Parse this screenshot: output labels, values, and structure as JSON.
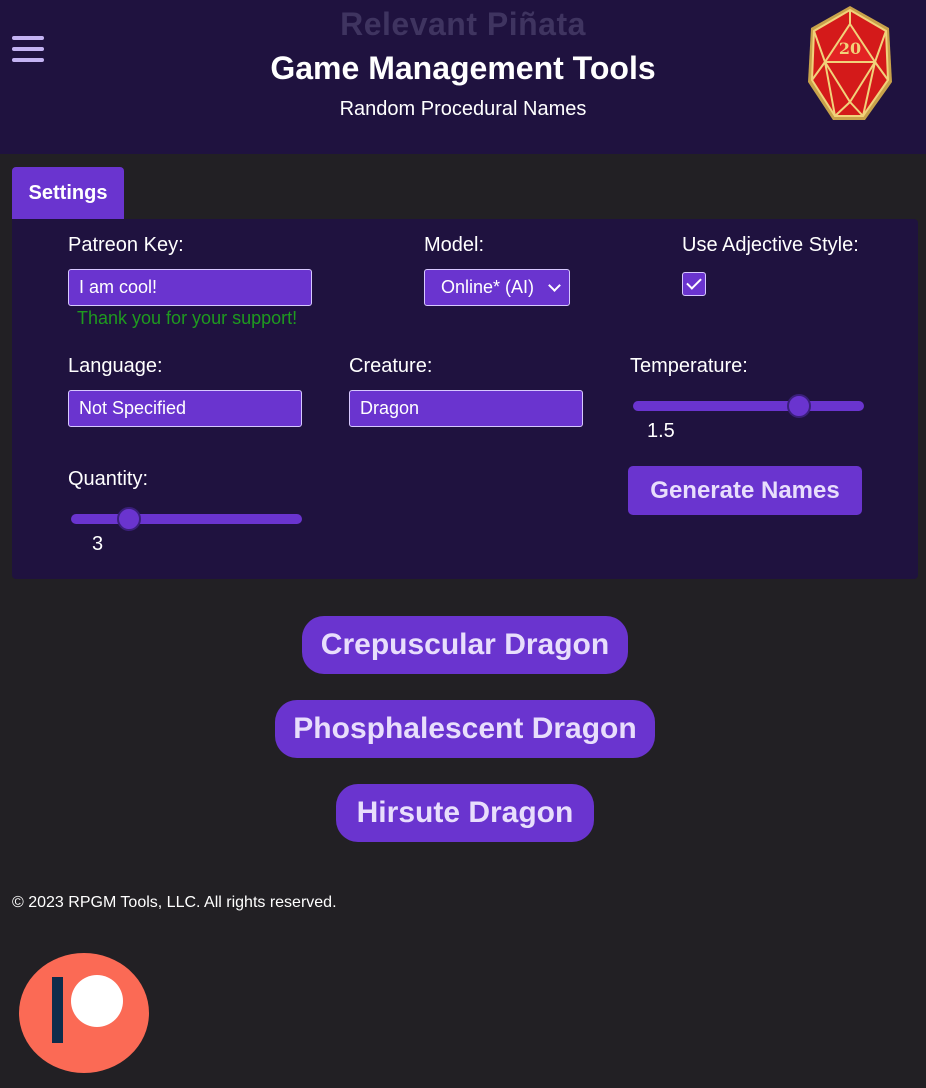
{
  "header": {
    "brand": "Relevant Piñata",
    "title": "Game Management Tools",
    "subtitle": "Random Procedural Names",
    "d20_number": "20"
  },
  "settings": {
    "tab_label": "Settings",
    "patreon_label": "Patreon Key:",
    "patreon_value": "I am cool!",
    "support_message": "Thank you for your support!",
    "model_label": "Model:",
    "model_value": "Online* (AI)",
    "adjective_label": "Use Adjective Style:",
    "adjective_checked": true,
    "language_label": "Language:",
    "language_value": "Not Specified",
    "creature_label": "Creature:",
    "creature_value": "Dragon",
    "temperature_label": "Temperature:",
    "temperature_value": "1.5",
    "temperature_fraction": 0.72,
    "quantity_label": "Quantity:",
    "quantity_value": "3",
    "quantity_fraction": 0.25,
    "generate_label": "Generate Names"
  },
  "results": [
    "Crepuscular Dragon",
    "Phosphalescent Dragon",
    "Hirsute Dragon"
  ],
  "footer": {
    "copyright": "© 2023 RPGM Tools, LLC. All rights reserved."
  },
  "colors": {
    "header_bg": "#1f123f",
    "accent": "#6a34cf",
    "page_bg": "#222024",
    "success": "#1f9a1f",
    "patreon": "#fb6a55"
  }
}
